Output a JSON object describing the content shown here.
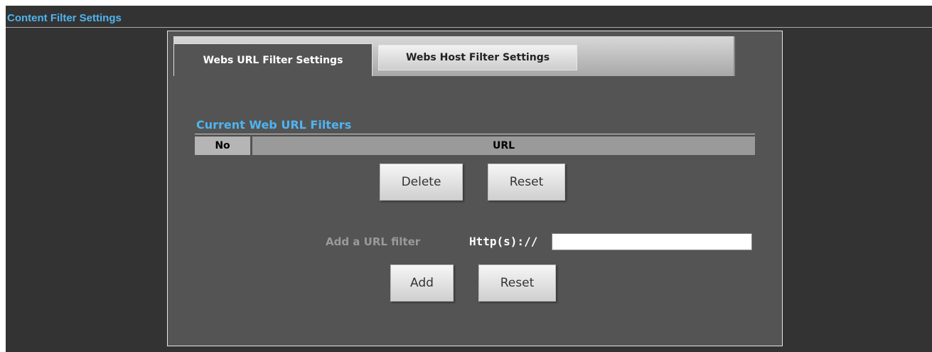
{
  "section": {
    "title": "Content Filter Settings"
  },
  "tabs": [
    {
      "label": "Webs URL Filter Settings",
      "active": true
    },
    {
      "label": "Webs Host Filter Settings",
      "active": false
    }
  ],
  "filters": {
    "heading": "Current Web URL Filters",
    "columns": [
      "No",
      "URL"
    ],
    "rows": [],
    "delete_label": "Delete",
    "reset_label": "Reset"
  },
  "add_form": {
    "label": "Add a URL filter",
    "prefix": "Http(s)://",
    "input_value": "",
    "add_label": "Add",
    "reset_label": "Reset"
  },
  "colors": {
    "accent": "#4fb4f0",
    "page_bg": "#333333",
    "panel_bg": "#545454"
  }
}
